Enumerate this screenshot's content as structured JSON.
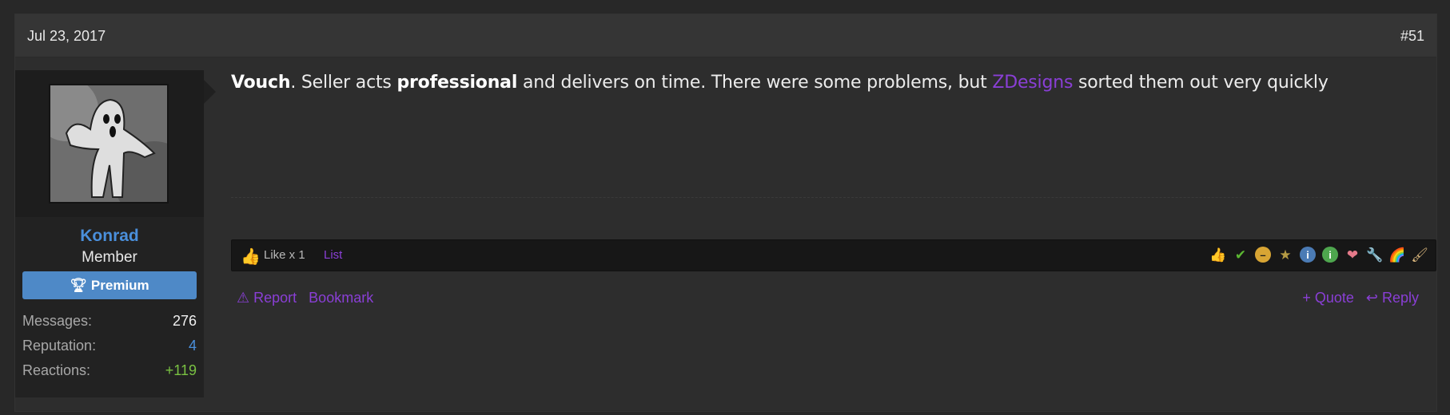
{
  "post": {
    "date": "Jul 23, 2017",
    "number": "#51"
  },
  "user": {
    "name": "Konrad",
    "title": "Member",
    "badge": "Premium",
    "stats": [
      {
        "key": "Messages:",
        "value": "276"
      },
      {
        "key": "Reputation:",
        "value": "4"
      },
      {
        "key": "Reactions:",
        "value": "+119"
      }
    ]
  },
  "message": {
    "part1_bold": "Vouch",
    "part2": ". Seller acts ",
    "part3_bold": "professional",
    "part4": " and delivers on time. There were some problems, but ",
    "mention": "ZDesigns",
    "part5": " sorted them out very quickly"
  },
  "reactions_bar": {
    "like_text": "Like x 1",
    "list_label": "List",
    "icons": [
      "thumbs-up-icon",
      "check-icon",
      "meh-icon",
      "star-award-icon",
      "info-blue-icon",
      "info-green-icon",
      "heart-icon",
      "wrench-icon",
      "rainbow-icon",
      "brush-icon"
    ]
  },
  "actions": {
    "report": "Report",
    "bookmark": "Bookmark",
    "quote": "+ Quote",
    "reply": "Reply"
  },
  "colors": {
    "accent": "#8a3fd6",
    "username": "#4a8fdb",
    "premium_badge": "#4e89c7",
    "positive": "#79c142"
  }
}
